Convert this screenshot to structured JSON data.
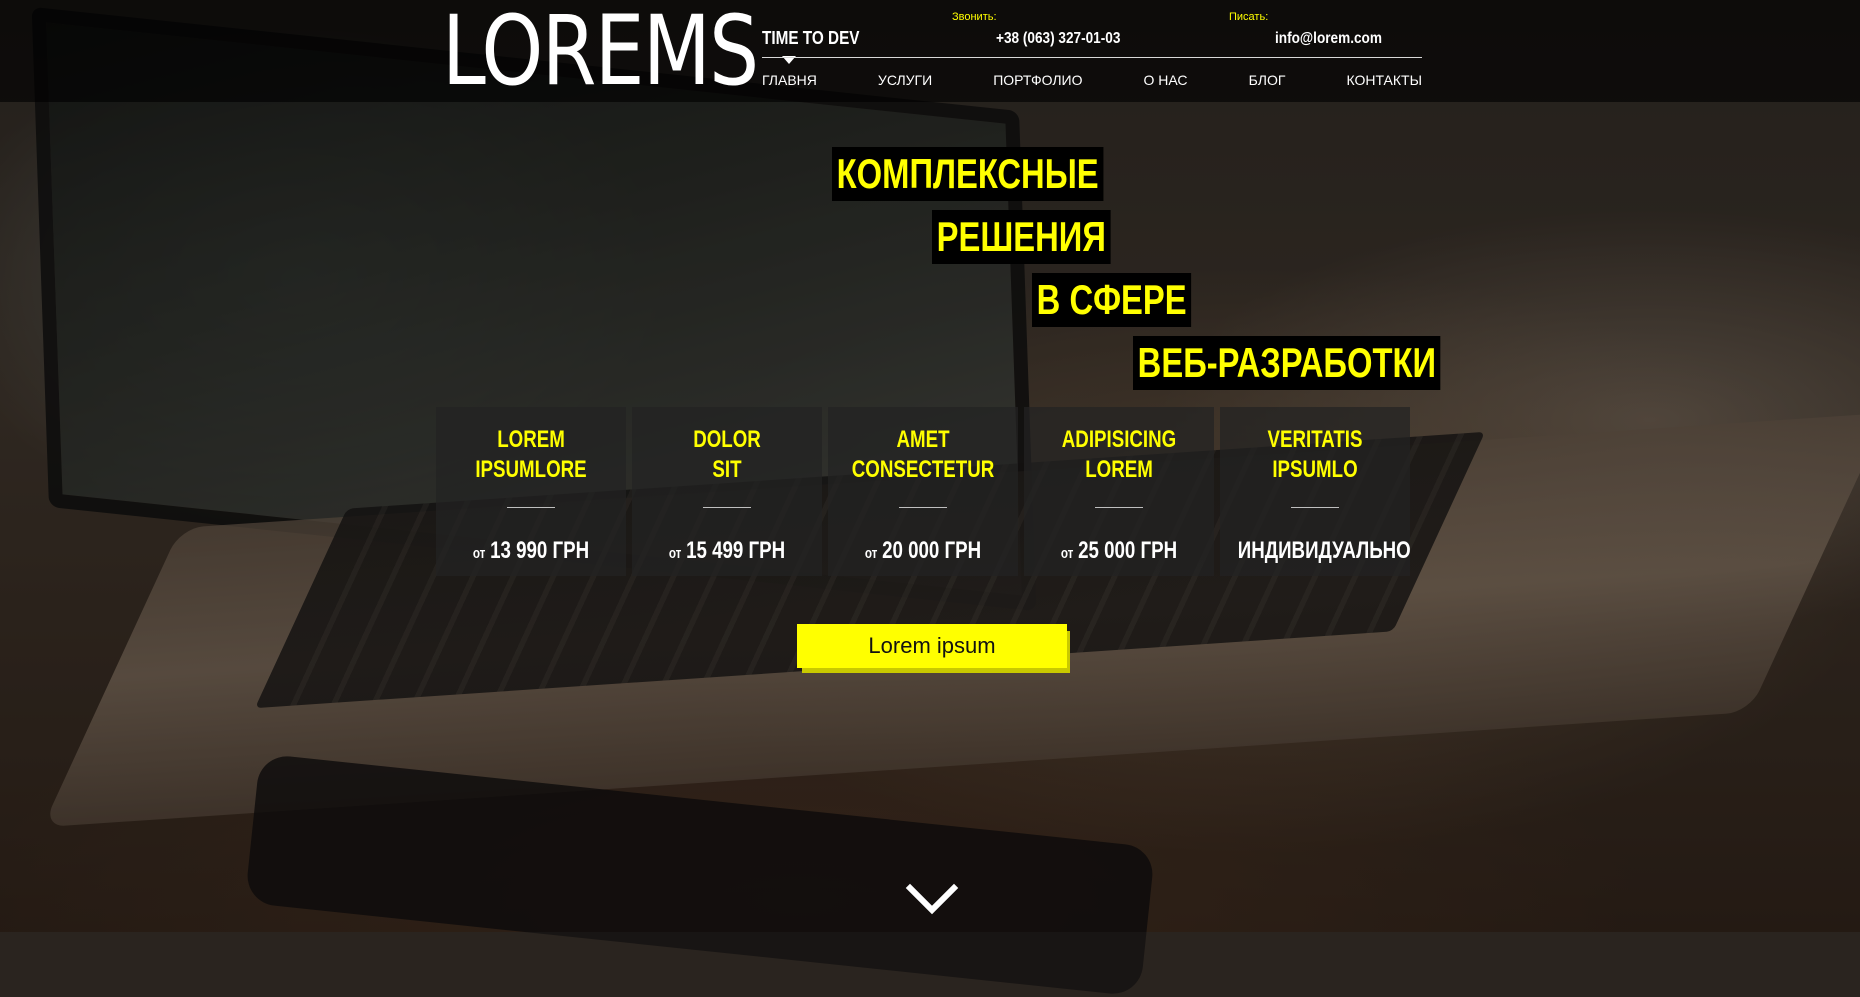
{
  "header": {
    "logo": "LOREMS",
    "tagline": "TIME TO DEV",
    "phone_label": "Звонить:",
    "phone": "+38 (063) 327-01-03",
    "email_label": "Писать:",
    "email": "info@lorem.com",
    "nav": [
      "ГЛАВНЯ",
      "УСЛУГИ",
      "ПОРТФОЛИО",
      "О НАС",
      "БЛОГ",
      "КОНТАКТЫ"
    ]
  },
  "hero": {
    "lines": [
      "КОМПЛЕКСНЫЕ",
      "РЕШЕНИЯ",
      "В СФЕРЕ",
      "ВЕБ-РАЗРАБОТКИ"
    ]
  },
  "cards": [
    {
      "title_1": "LOREM",
      "title_2": "IPSUMLORE",
      "from": "от",
      "price": "13 990 ГРН"
    },
    {
      "title_1": "DOLOR",
      "title_2": "SIT",
      "from": "от",
      "price": "15 499 ГРН"
    },
    {
      "title_1": "AMET",
      "title_2": "CONSECTETUR",
      "from": "от",
      "price": "20 000 ГРН"
    },
    {
      "title_1": "ADIPISICING",
      "title_2": "LOREM",
      "from": "от",
      "price": "25 000 ГРН"
    },
    {
      "title_1": "VERITATIS",
      "title_2": "IPSUMLO",
      "from": "",
      "price": "ИНДИВИДУАЛЬНО"
    }
  ],
  "cta": {
    "label": "Lorem ipsum"
  },
  "icons": {
    "scroll": "chevron-down-icon",
    "nav_marker": "caret-down-icon"
  },
  "colors": {
    "accent": "#ffff00",
    "text": "#ffffff",
    "header_bg": "#000000"
  }
}
